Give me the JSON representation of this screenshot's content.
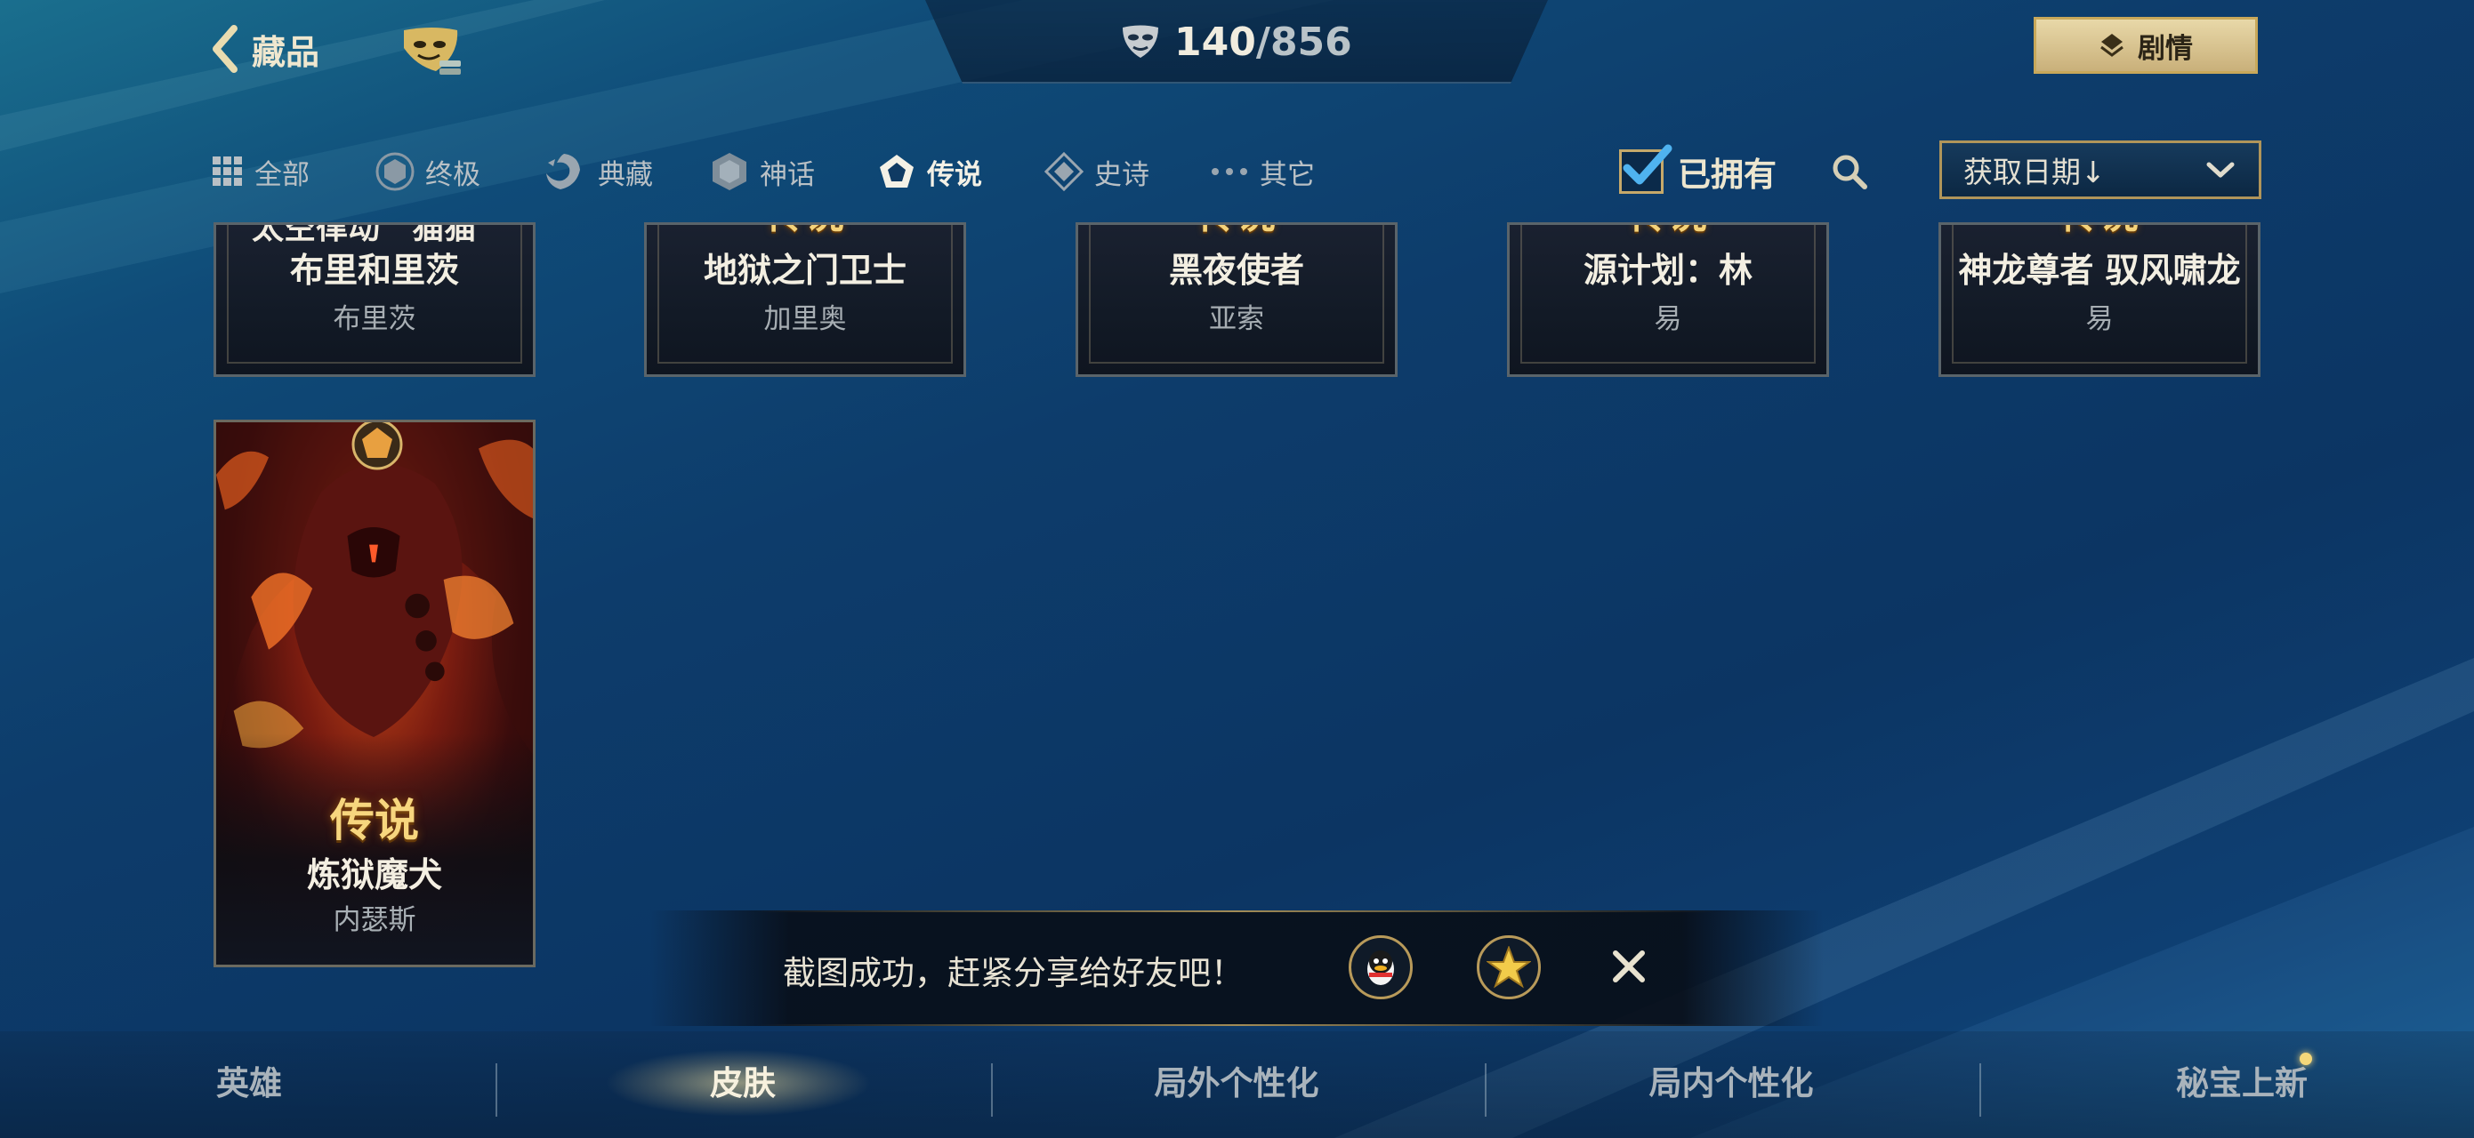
{
  "header": {
    "back_label": "藏品",
    "count_owned": "140",
    "count_sep": "/",
    "count_total": "856",
    "story_label": "剧情"
  },
  "filters": {
    "tabs": [
      {
        "label": "全部",
        "icon": "grid-icon"
      },
      {
        "label": "终极",
        "icon": "hexagon-icon"
      },
      {
        "label": "典藏",
        "icon": "dragon-icon"
      },
      {
        "label": "神话",
        "icon": "hexagon-icon"
      },
      {
        "label": "传说",
        "icon": "pentagon-icon",
        "active": true
      },
      {
        "label": "史诗",
        "icon": "diamond-icon"
      },
      {
        "label": "其它",
        "icon": "dots-icon"
      }
    ],
    "owned_label": "已拥有",
    "owned_checked": true,
    "sort_label": "获取日期↓"
  },
  "cards_row1": [
    {
      "tier": "太空律动 “猫猫”",
      "skin": "布里和里茨",
      "champion": "布里茨"
    },
    {
      "tier": "传说",
      "skin": "地狱之门卫士",
      "champion": "加里奥"
    },
    {
      "tier": "传说",
      "skin": "黑夜使者",
      "champion": "亚索"
    },
    {
      "tier": "传说",
      "skin": "源计划：林",
      "champion": "易"
    },
    {
      "tier": "传说",
      "skin": "神龙尊者 驭风啸龙",
      "champion": "易"
    }
  ],
  "card_big": {
    "tier": "传说",
    "skin": "炼狱魔犬",
    "champion": "内瑟斯"
  },
  "toast": {
    "message": "截图成功，赶紧分享给好友吧！"
  },
  "bottom_nav": [
    {
      "label": "英雄"
    },
    {
      "label": "皮肤",
      "active": true
    },
    {
      "label": "局外个性化"
    },
    {
      "label": "局内个性化"
    },
    {
      "label": "秘宝上新"
    }
  ],
  "colors": {
    "accent_gold": "#c8a85a",
    "text_light": "#f3efe2",
    "text_muted": "#a7aeb3"
  }
}
